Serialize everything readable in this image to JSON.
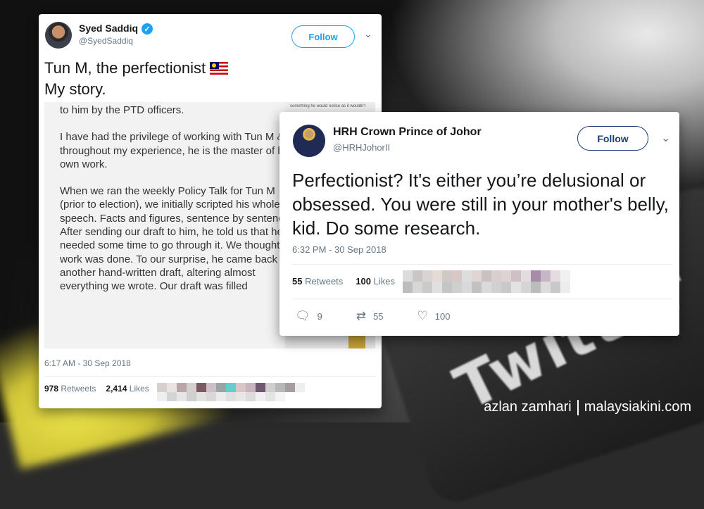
{
  "tweet1": {
    "name": "Syed Saddiq",
    "handle": "@SyedSaddiq",
    "follow_label": "Follow",
    "text_line1": "Tun M, the perfectionist",
    "text_line2": "My story.",
    "image_text": {
      "p0": "to him by the PTD officers.",
      "p1": "I have had the privilege of working with Tun M & throughout my experience, he is the master of his own work.",
      "p2": "When we ran the weekly Policy Talk for Tun M (prior to election), we initially scripted his whole speech. Facts and figures, sentence by sentence. After sending our draft to him, he told us that he needed some time to go through it. We thought our work was done. To our surprise, he came back with another hand-written draft, altering almost everything we wrote. Our draft was filled",
      "side": "something he would notice as it wouldn't"
    },
    "timestamp": "6:17 AM - 30 Sep 2018",
    "retweets_count": "978",
    "retweets_label": "Retweets",
    "likes_count": "2,414",
    "likes_label": "Likes"
  },
  "tweet2": {
    "name": "HRH Crown Prince of Johor",
    "handle": "@HRHJohorII",
    "follow_label": "Follow",
    "text": "Perfectionist? It's either you’re delusional or obsessed. You were still in your mother's belly, kid. Do some research.",
    "timestamp": "6:32 PM - 30 Sep 2018",
    "retweets_count": "55",
    "retweets_label": "Retweets",
    "likes_count": "100",
    "likes_label": "Likes",
    "reply_count": "9",
    "retweet_action_count": "55",
    "like_action_count": "100"
  },
  "background": {
    "watermark_word": "Twitter"
  },
  "credit": {
    "photographer": "azlan zamhari",
    "site": "malaysiakini.com"
  },
  "colors": {
    "twitter_blue": "#1da1f2",
    "text": "#14171a",
    "muted": "#657786"
  },
  "icons": [
    "verified-badge-icon",
    "chevron-down-icon",
    "reply-icon",
    "retweet-icon",
    "heart-icon",
    "malaysia-flag-icon"
  ]
}
